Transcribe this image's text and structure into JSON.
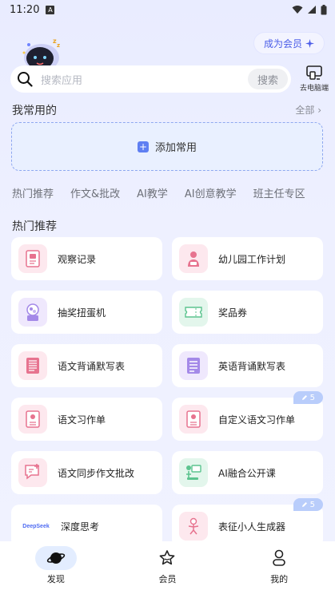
{
  "status_bar": {
    "time": "11:20"
  },
  "header": {
    "vip_label": "成为会员",
    "vip_icon": "sparkle-icon"
  },
  "search": {
    "placeholder": "搜索应用",
    "button_label": "搜索",
    "pc_label": "去电脑端"
  },
  "favorites": {
    "title": "我常用的",
    "all_label": "全部 ›",
    "add_label": "添加常用"
  },
  "tabs": [
    "热门推荐",
    "作文&批改",
    "AI教学",
    "AI创意教学",
    "班主任专区"
  ],
  "hot": {
    "title": "热门推荐",
    "items": [
      {
        "label": "观察记录",
        "icon": "observation-record-icon",
        "color": "#fde8ee"
      },
      {
        "label": "幼儿园工作计划",
        "icon": "kindergarten-plan-icon",
        "color": "#fde8ee"
      },
      {
        "label": "抽奖扭蛋机",
        "icon": "gacha-machine-icon",
        "color": "#efe8fd"
      },
      {
        "label": "奖品券",
        "icon": "coupon-icon",
        "color": "#e3f6ec"
      },
      {
        "label": "语文背诵默写表",
        "icon": "chinese-recite-sheet-icon",
        "color": "#fde8ee"
      },
      {
        "label": "英语背诵默写表",
        "icon": "english-recite-sheet-icon",
        "color": "#efe8fd"
      },
      {
        "label": "语文习作单",
        "icon": "chinese-writing-sheet-icon",
        "color": "#fde8ee"
      },
      {
        "label": "自定义语文习作单",
        "icon": "custom-writing-sheet-icon",
        "color": "#fde8ee",
        "badge": "5"
      },
      {
        "label": "语文同步作文批改",
        "icon": "essay-correction-icon",
        "color": "#fde8ee"
      },
      {
        "label": "AI融合公开课",
        "icon": "ai-open-class-icon",
        "color": "#e3f6ec"
      },
      {
        "label": "深度思考",
        "icon": "deepseek-logo",
        "color": "#ffffff",
        "logo_text": "DeepSeek"
      },
      {
        "label": "表征小人生成器",
        "icon": "figure-generator-icon",
        "color": "#fde8ee",
        "badge": "5"
      }
    ]
  },
  "bottom_nav": [
    {
      "label": "发现",
      "icon": "planet-icon",
      "active": true
    },
    {
      "label": "会员",
      "icon": "star-badge-icon",
      "active": false
    },
    {
      "label": "我的",
      "icon": "person-icon",
      "active": false
    }
  ]
}
